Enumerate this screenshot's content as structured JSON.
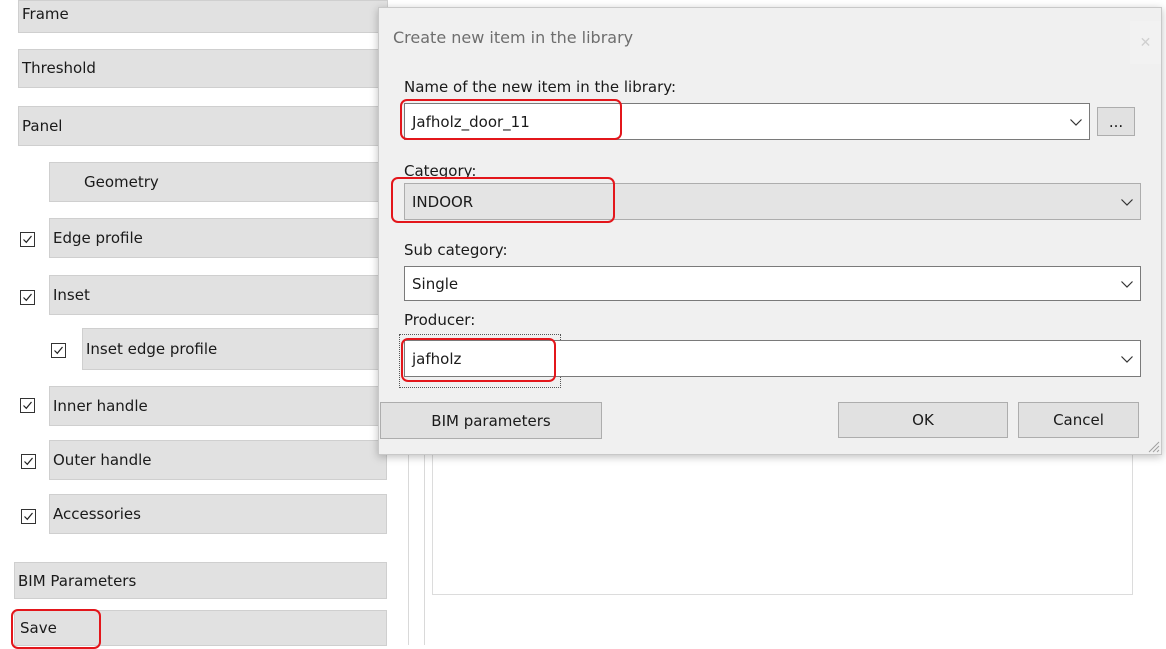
{
  "left_panel": {
    "frame": "Frame",
    "threshold": "Threshold",
    "panel": "Panel",
    "geometry": "Geometry",
    "edge_profile": "Edge profile",
    "inset": "Inset",
    "inset_edge_profile": "Inset edge profile",
    "inner_handle": "Inner handle",
    "outer_handle": "Outer handle",
    "accessories": "Accessories",
    "bim_parameters": "BIM Parameters",
    "save": "Save"
  },
  "dialog": {
    "title": "Create new item in the library",
    "close_icon": "close-icon",
    "name_label": "Name of the new item in the library:",
    "name_value": "Jafholz_door_11",
    "browse_label": "...",
    "category_label": "Category:",
    "category_value": "INDOOR",
    "subcategory_label": "Sub category:",
    "subcategory_value": "Single",
    "producer_label": "Producer:",
    "producer_value": "jafholz",
    "bim_button": "BIM parameters",
    "ok_button": "OK",
    "cancel_button": "Cancel"
  },
  "colors": {
    "highlight": "#e3161b",
    "button_face": "#e1e1e1",
    "dialog_bg": "#f0f0f0"
  }
}
